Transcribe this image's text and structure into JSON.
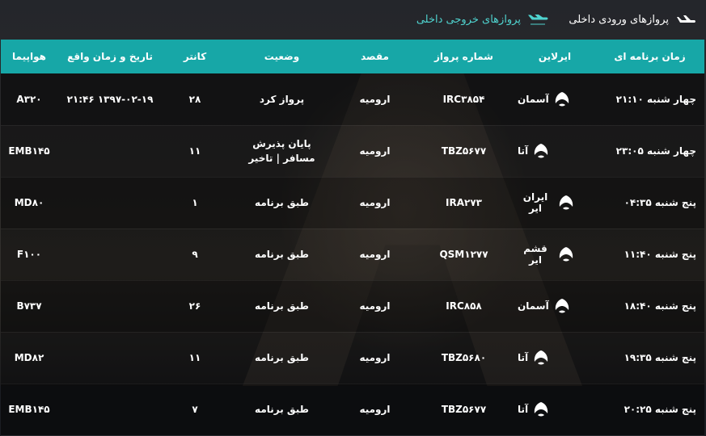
{
  "tabs": {
    "arrivals": "پروازهای ورودی داخلی",
    "departures": "پروازهای خروجی داخلی"
  },
  "colors": {
    "accent": "#17a7a7",
    "tab_active": "#4fd3cf"
  },
  "table": {
    "headers": {
      "time": "زمان برنامه ای",
      "airline": "ایرلاین",
      "flight": "شماره پرواز",
      "destination": "مقصد",
      "status": "وضعیت",
      "counter": "کانتر",
      "actual": "تاریخ و زمان واقع",
      "aircraft": "هواپیما"
    },
    "rows": [
      {
        "time": "چهار شنبه ۲۱:۱۰",
        "airline": "آسمان",
        "logo": "aseman-logo",
        "flight": "IRC۳۸۵۴",
        "destination": "ارومیه",
        "status": "پرواز کرد",
        "counter": "۲۸",
        "actual": "۱۳۹۷-۰۲-۱۹ ۲۱:۴۶",
        "aircraft": "A۳۲۰"
      },
      {
        "time": "چهار شنبه ۲۳:۰۵",
        "airline": "آتا",
        "logo": "ata-logo",
        "flight": "TBZ۵۶۷۷",
        "destination": "ارومیه",
        "status": "پایان پذیرش مسافر | تاخیر",
        "counter": "۱۱",
        "actual": "",
        "aircraft": "EMB۱۴۵"
      },
      {
        "time": "پنج شنبه ۰۴:۳۵",
        "airline": "ایران ایر",
        "logo": "iranair-logo",
        "flight": "IRA۲۷۳",
        "destination": "ارومیه",
        "status": "طبق برنامه",
        "counter": "۱",
        "actual": "",
        "aircraft": "MD۸۰"
      },
      {
        "time": "پنج شنبه ۱۱:۴۰",
        "airline": "قشم ایر",
        "logo": "qeshm-logo",
        "flight": "QSM۱۲۷۷",
        "destination": "ارومیه",
        "status": "طبق برنامه",
        "counter": "۹",
        "actual": "",
        "aircraft": "F۱۰۰"
      },
      {
        "time": "پنج شنبه ۱۸:۴۰",
        "airline": "آسمان",
        "logo": "aseman-logo",
        "flight": "IRC۸۵۸",
        "destination": "ارومیه",
        "status": "طبق برنامه",
        "counter": "۲۶",
        "actual": "",
        "aircraft": "B۷۳۷"
      },
      {
        "time": "پنج شنبه ۱۹:۳۵",
        "airline": "آتا",
        "logo": "ata-logo",
        "flight": "TBZ۵۶۸۰",
        "destination": "ارومیه",
        "status": "طبق برنامه",
        "counter": "۱۱",
        "actual": "",
        "aircraft": "MD۸۲"
      },
      {
        "time": "پنج شنبه ۲۰:۲۵",
        "airline": "آتا",
        "logo": "ata-logo",
        "flight": "TBZ۵۶۷۷",
        "destination": "ارومیه",
        "status": "طبق برنامه",
        "counter": "۷",
        "actual": "",
        "aircraft": "EMB۱۴۵"
      }
    ]
  }
}
